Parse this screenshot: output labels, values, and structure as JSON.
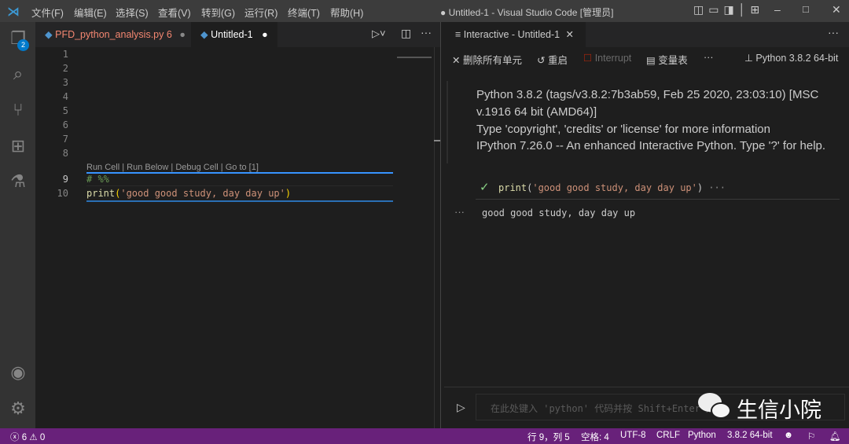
{
  "titlebar": {
    "menu": [
      "文件(F)",
      "编辑(E)",
      "选择(S)",
      "查看(V)",
      "转到(G)",
      "运行(R)",
      "终端(T)",
      "帮助(H)"
    ],
    "title": "● Untitled-1 - Visual Studio Code [管理员]"
  },
  "activity": {
    "explorer_badge": "2"
  },
  "editor": {
    "tabs": [
      {
        "label": "PFD_python_analysis.py",
        "problems": "6"
      },
      {
        "label": "Untitled-1"
      }
    ],
    "line_numbers": [
      "1",
      "2",
      "3",
      "4",
      "5",
      "6",
      "7",
      "8",
      "9",
      "10"
    ],
    "codelens": "Run Cell | Run Below | Debug Cell | Go to [1]",
    "cell_marker": "# %%",
    "code_fn": "print",
    "code_open": "(",
    "code_str": "'good good study, day day up'",
    "code_close": ")"
  },
  "interactive": {
    "tab": "Interactive - Untitled-1",
    "toolbar": {
      "clear": "删除所有单元",
      "restart": "重启",
      "interrupt": "Interrupt",
      "variables": "变量表",
      "kernel": "Python 3.8.2 64-bit"
    },
    "sysinfo": [
      "Python 3.8.2 (tags/v3.8.2:7b3ab59, Feb 25 2020, 23:03:10) [MSC",
      "v.1916 64 bit (AMD64)]",
      "Type 'copyright', 'credits' or 'license' for more information",
      "IPython 7.26.0 -- An enhanced Interactive Python. Type '?' for help."
    ],
    "cell_fn": "print",
    "cell_str": "'good good study, day day up'",
    "output": "good good study, day day up",
    "input_placeholder": "在此处键入 'python' 代码并按 Shift+Enter 运行",
    "watermark": "生信小院"
  },
  "status": {
    "errors": "6",
    "warnings": "0",
    "position": "行 9，列 5",
    "spaces": "空格: 4",
    "encoding": "UTF-8",
    "eol": "CRLF",
    "language": "Python",
    "interpreter": "3.8.2 64-bit"
  }
}
